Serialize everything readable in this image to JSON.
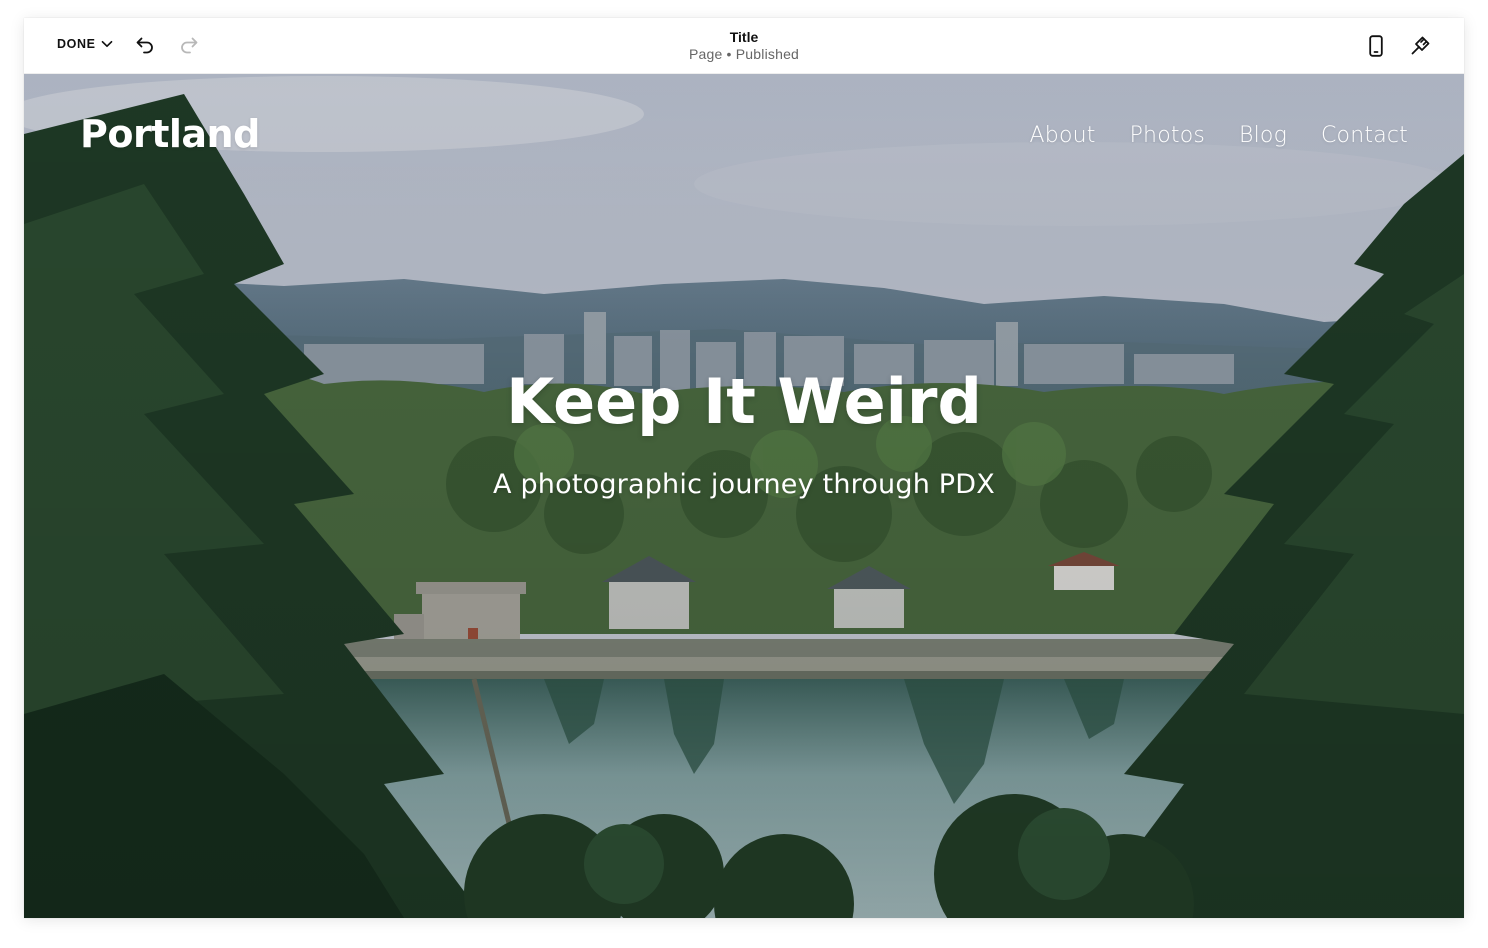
{
  "toolbar": {
    "done_label": "DONE",
    "page_title": "Title",
    "page_type": "Page",
    "status_separator": "•",
    "page_status": "Published",
    "icons": {
      "done_chevron": "chevron-down-icon",
      "undo": "undo-icon",
      "redo": "redo-icon",
      "mobile_preview": "mobile-phone-icon",
      "site_styles": "paintbrush-icon"
    }
  },
  "site": {
    "logo": "Portland",
    "nav": [
      {
        "label": "About"
      },
      {
        "label": "Photos"
      },
      {
        "label": "Blog"
      },
      {
        "label": "Contact"
      }
    ]
  },
  "hero": {
    "heading": "Keep It Weird",
    "subheading": "A photographic journey through PDX",
    "background_image": "photo of Portland skyline beyond a reservoir, framed by evergreen trees"
  },
  "colors": {
    "toolbar_bg": "#ffffff",
    "hero_text": "#ffffff",
    "redo_disabled": "#b8b8b8"
  }
}
